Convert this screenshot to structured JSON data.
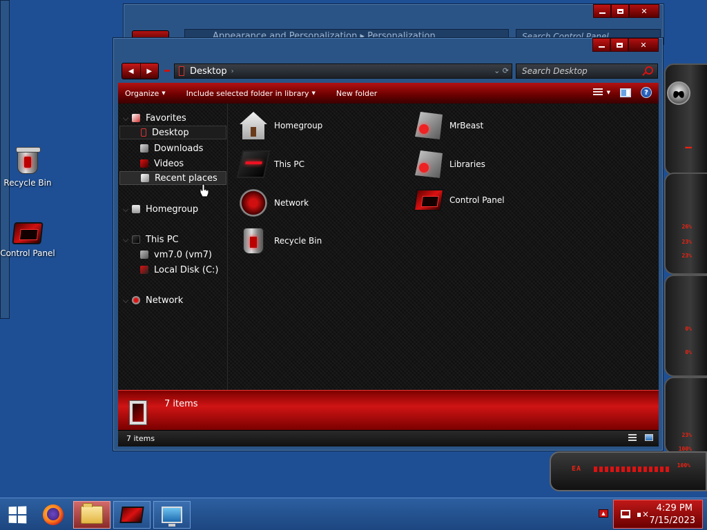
{
  "desktop": {
    "icons": [
      {
        "label": "Recycle Bin"
      },
      {
        "label": "Control Panel"
      }
    ]
  },
  "back_window": {
    "address": "Appearance and Personalization  ▸  Personalization",
    "search_placeholder": "Search Control Panel"
  },
  "window": {
    "address": {
      "location": "Desktop"
    },
    "search_placeholder": "Search Desktop",
    "toolbar": {
      "organize": "Organize",
      "include": "Include selected folder in library",
      "new_folder": "New folder",
      "help": "?"
    },
    "navpane": {
      "favorites": "Favorites",
      "desktop": "Desktop",
      "downloads": "Downloads",
      "videos": "Videos",
      "recent": "Recent places",
      "homegroup": "Homegroup",
      "thispc": "This PC",
      "vm": "vm7.0 (vm7)",
      "localdisk": "Local Disk (C:)",
      "network": "Network"
    },
    "items": [
      {
        "label": "Homegroup",
        "icon": "homegroup-icon"
      },
      {
        "label": "MrBeast",
        "icon": "user-folder-icon"
      },
      {
        "label": "This PC",
        "icon": "computer-icon"
      },
      {
        "label": "Libraries",
        "icon": "libraries-icon"
      },
      {
        "label": "Network",
        "icon": "network-icon"
      },
      {
        "label": "Control Panel",
        "icon": "control-panel-icon"
      },
      {
        "label": "Recycle Bin",
        "icon": "recycle-bin-icon"
      }
    ],
    "details": {
      "count": "7 items"
    },
    "status": {
      "count": "7 items"
    }
  },
  "gadgets": {
    "percentages": [
      "26%",
      "23%",
      "23%",
      "0%",
      "0%",
      "23%",
      "100%",
      "100%"
    ],
    "bottom_label": "EA"
  },
  "taskbar": {
    "time": "4:29 PM",
    "date": "7/15/2023"
  },
  "colors": {
    "desktop": "#1e4f94",
    "accent_red": "#c01515",
    "window_frame": "#2b5486"
  }
}
